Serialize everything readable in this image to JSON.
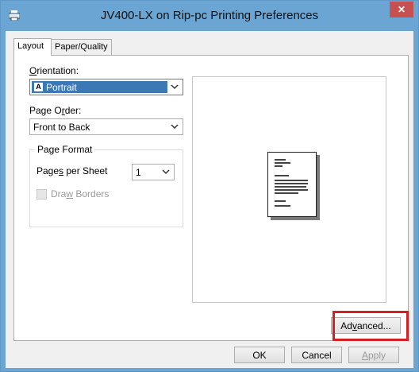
{
  "window": {
    "title": "JV400-LX on Rip-pc Printing Preferences",
    "close_glyph": "✕"
  },
  "tabs": [
    {
      "label": "Layout"
    },
    {
      "label": "Paper/Quality"
    }
  ],
  "layout": {
    "orientation_label_pre": "",
    "orientation_label_ul": "O",
    "orientation_label_post": "rientation:",
    "orientation_value": "Portrait",
    "page_order_label_pre": "Page O",
    "page_order_label_ul": "r",
    "page_order_label_post": "der:",
    "page_order_value": "Front to Back",
    "page_format_title": "Page Format",
    "pages_per_sheet_label_pre": "Page",
    "pages_per_sheet_label_ul": "s",
    "pages_per_sheet_label_post": " per Sheet",
    "pages_per_sheet_value": "1",
    "draw_borders_pre": "Dra",
    "draw_borders_ul": "w",
    "draw_borders_post": " Borders"
  },
  "buttons": {
    "advanced_pre": "Ad",
    "advanced_ul": "v",
    "advanced_post": "anced...",
    "ok": "OK",
    "cancel": "Cancel",
    "apply_pre": "",
    "apply_ul": "A",
    "apply_post": "pply"
  },
  "colors": {
    "titlebar": "#6aa5d3",
    "close": "#c75050",
    "selection": "#3c78b4",
    "highlight_box": "#d42020"
  }
}
